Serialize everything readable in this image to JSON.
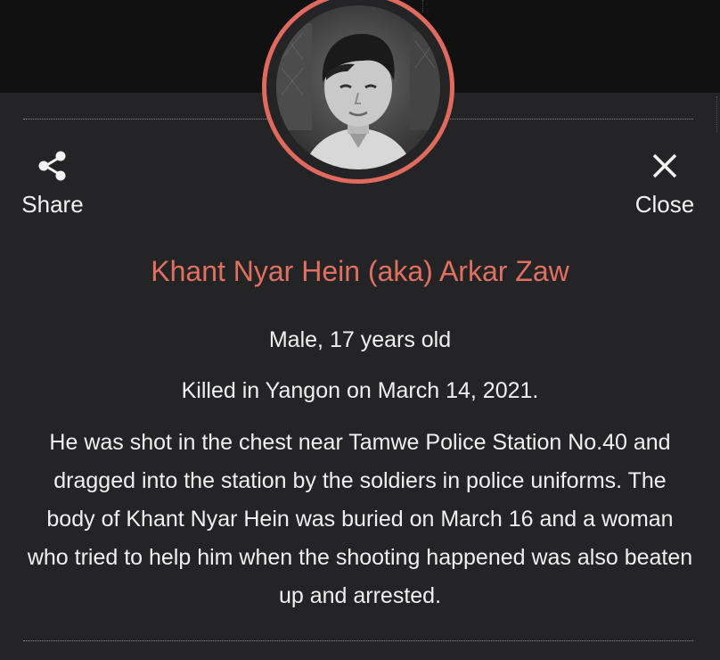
{
  "profile": {
    "name": "Khant Nyar Hein (aka) Arkar Zaw",
    "details": "Male, 17 years old",
    "killed": "Killed in Yangon on March 14, 2021.",
    "story": "He was shot in the chest near Tamwe Police Station No.40 and dragged into the station by the soldiers in police uniforms. The body of Khant Nyar Hein was buried on March 16 and a woman who tried to help him when the shooting happened was also beaten up and arrested."
  },
  "actions": {
    "share_label": "Share",
    "share_icon": "share-icon",
    "close_label": "Close",
    "close_icon": "close-icon"
  },
  "colors": {
    "accent": "#e06a5e",
    "background": "#242426",
    "header_background": "#111112",
    "text": "#f0f0f0"
  }
}
